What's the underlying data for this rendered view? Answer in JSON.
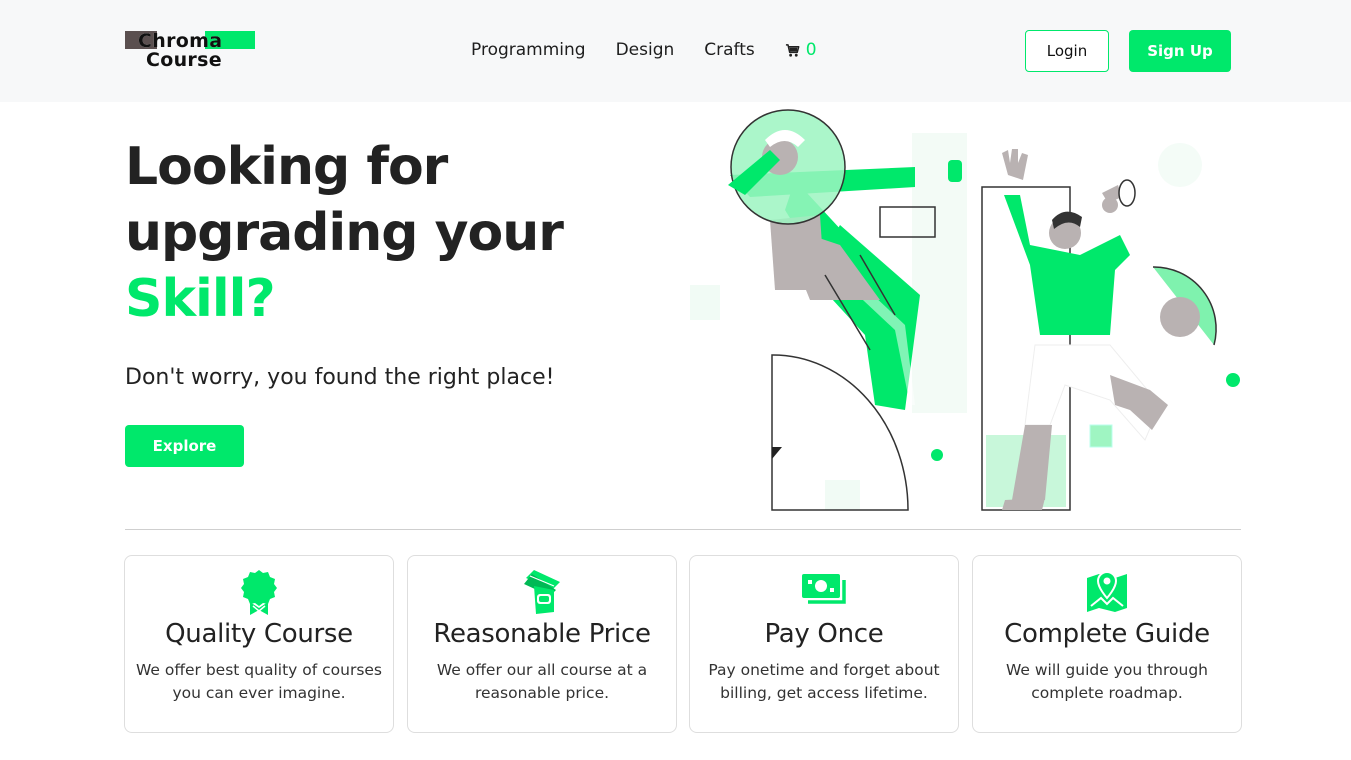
{
  "brand": {
    "line1": "Chroma",
    "line2": "Course"
  },
  "nav": {
    "items": [
      {
        "label": "Programming"
      },
      {
        "label": "Design"
      },
      {
        "label": "Crafts"
      }
    ],
    "cart_count": "0"
  },
  "auth": {
    "login_label": "Login",
    "signup_label": "Sign Up"
  },
  "hero": {
    "title_line1": "Looking for",
    "title_line2": "upgrading your",
    "title_accent": "Skill?",
    "subtitle": "Don't worry, you found the right place!",
    "cta_label": "Explore"
  },
  "features": [
    {
      "icon": "award-badge-icon",
      "title": "Quality Course",
      "text": "We offer best quality of courses you can ever imagine."
    },
    {
      "icon": "money-hand-icon",
      "title": "Reasonable Price",
      "text": "We offer our all course at a reasonable price."
    },
    {
      "icon": "banknote-icon",
      "title": "Pay Once",
      "text": "Pay onetime and forget about billing, get access lifetime."
    },
    {
      "icon": "map-pin-icon",
      "title": "Complete Guide",
      "text": "We will guide you through complete roadmap."
    }
  ],
  "colors": {
    "accent": "#00e86b",
    "dark": "#222222",
    "header_bg": "#f7f8f9",
    "illus_gray": "#b9b2b2"
  }
}
